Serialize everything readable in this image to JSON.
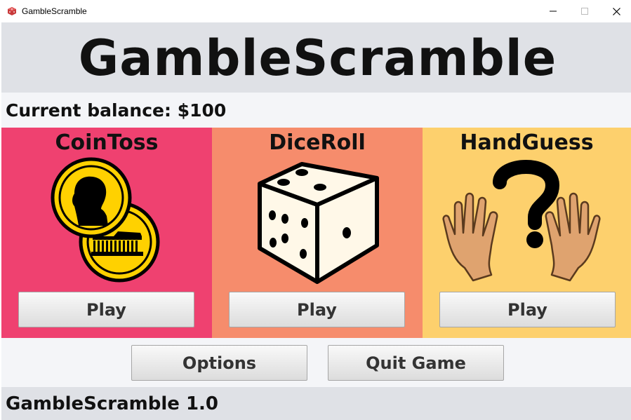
{
  "window": {
    "title": "GambleScramble",
    "controls": [
      "minimize",
      "maximize",
      "close"
    ]
  },
  "header": {
    "app_name": "GambleScramble"
  },
  "balance": {
    "text": "Current balance: $100"
  },
  "games": [
    {
      "name": "CoinToss",
      "icon": "coin-toss-icon",
      "play_label": "Play",
      "color": "#ef4170"
    },
    {
      "name": "DiceRoll",
      "icon": "dice-icon",
      "play_label": "Play",
      "color": "#f68c6c"
    },
    {
      "name": "HandGuess",
      "icon": "hand-guess-icon",
      "play_label": "Play",
      "color": "#fdd06d"
    }
  ],
  "actions": {
    "options_label": "Options",
    "quit_label": "Quit Game"
  },
  "footer": {
    "version": "GambleScramble 1.0"
  }
}
